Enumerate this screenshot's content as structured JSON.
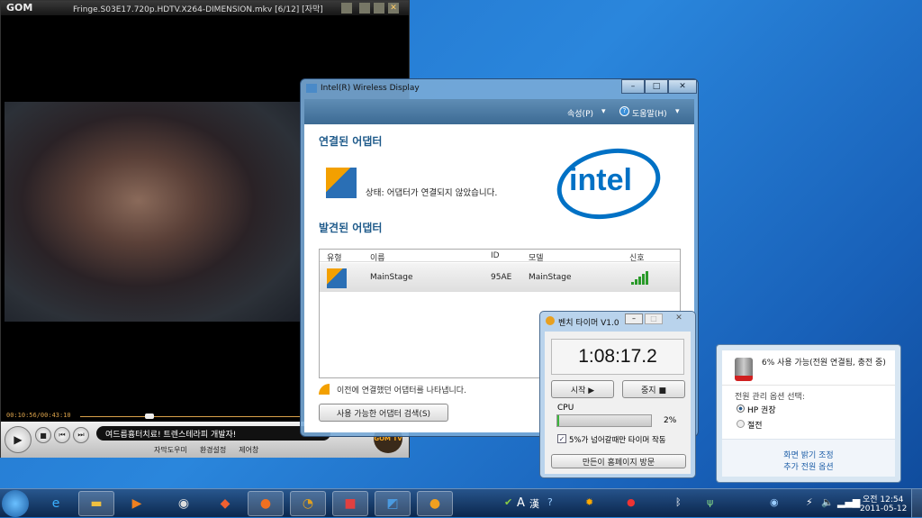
{
  "gom": {
    "logo": "GOM",
    "title": "Fringe.S03E17.720p.HDTV.X264-DIMENSION.mkv  [6/12] [자막]",
    "time": "00:10:56/00:43:10",
    "ticker": "여드름흉터치료! 트렌스테라피 개발자!",
    "links": [
      "자막도우미",
      "환경설정",
      "제어창"
    ],
    "tv_badge": "GOM TV",
    "progress": 0.25
  },
  "intel": {
    "title": "Intel(R) Wireless Display",
    "menu": [
      "속성(P)",
      "도움말(H)"
    ],
    "connected_heading": "연결된 어댑터",
    "status": "상태: 어댑터가 연결되지 않았습니다.",
    "logo": "intel",
    "found_heading": "발견된 어댑터",
    "columns": [
      "유형",
      "이름",
      "ID",
      "모델",
      "신호"
    ],
    "rows": [
      {
        "name": "MainStage",
        "id": "95AE",
        "model": "MainStage",
        "signal": 5
      }
    ],
    "note": "이전에 연결했던 어댑터를 나타냅니다.",
    "search_button": "사용 가능한 어댑터 검색(S)"
  },
  "timer": {
    "title": "벤치 타이머 V1.0",
    "time": "1:08:17.2",
    "start": "시작 ▶",
    "stop": "중지 ■",
    "cpu_label": "CPU",
    "cpu_value": "2%",
    "cpu_fraction": 0.02,
    "checkbox": "5%가 넘어갈때만 타이머 작동",
    "checked": true,
    "homepage": "만든이 홈페이지 방문"
  },
  "power": {
    "status": "6% 사용 가능(전원 연결됨, 충전 중)",
    "plan_label": "전원 관리 옵션 선택:",
    "plans": [
      "HP 권장",
      "절전"
    ],
    "selected": "HP 권장",
    "links": [
      "화면 밝기 조정",
      "추가 전원 옵션"
    ]
  },
  "taskbar": {
    "ime": [
      "A",
      "漢"
    ],
    "clock_time": "오전 12:54",
    "clock_date": "2011-05-12"
  },
  "colors": {
    "heading": "#1e5a8a",
    "intel_blue": "#0071c5",
    "link": "#1f5fa8"
  }
}
